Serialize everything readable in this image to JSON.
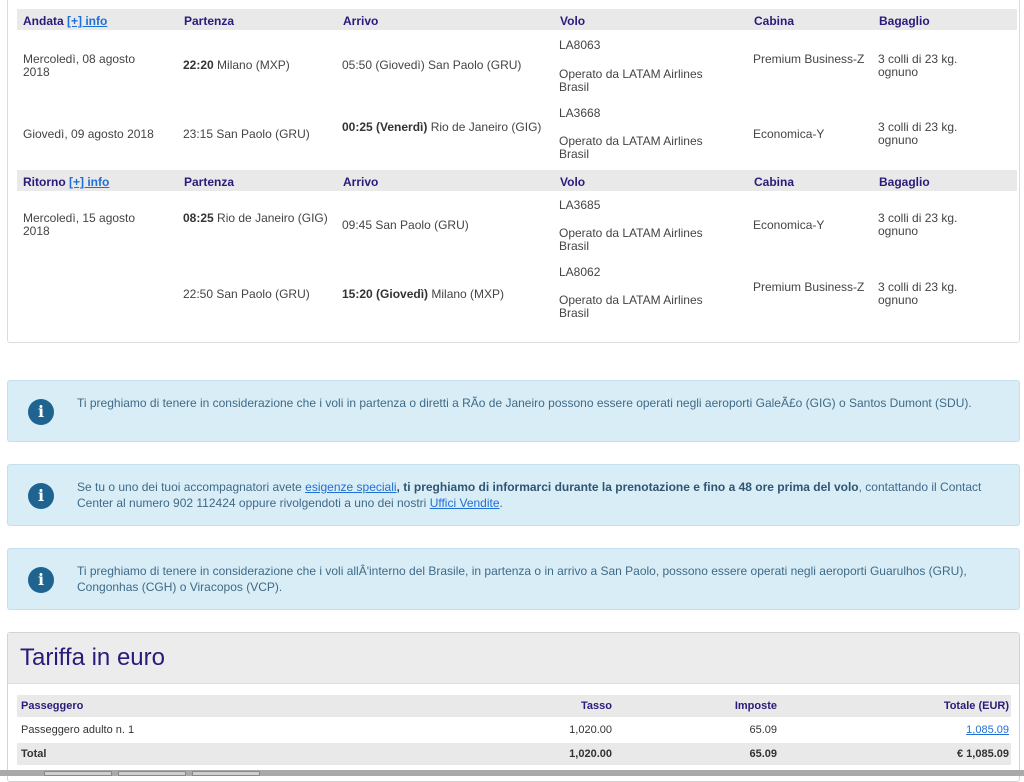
{
  "outbound": {
    "headers": {
      "section": "Andata",
      "info_link": "[+] info",
      "departure": "Partenza",
      "arrival": "Arrivo",
      "flight": "Volo",
      "cabin": "Cabina",
      "baggage": "Bagaglio"
    },
    "rows": [
      {
        "date": "Mercoledì, 08 agosto 2018",
        "dep_time": "22:20",
        "dep_place": "Milano (MXP)",
        "arr_time": "",
        "arr_place": "05:50 (Giovedì) San Paolo (GRU)",
        "flight_no": "LA8063",
        "operated": "Operato da LATAM Airlines Brasil",
        "cabin": "Premium Business-Z",
        "baggage": "3 colli di 23 kg. ognuno"
      },
      {
        "date": "Giovedì, 09 agosto 2018",
        "dep_time": "",
        "dep_place": "23:15 San Paolo (GRU)",
        "arr_time": "00:25 (Venerdì)",
        "arr_place": "Rio de Janeiro (GIG)",
        "flight_no": "LA3668",
        "operated": "Operato da LATAM Airlines Brasil",
        "cabin": "Economica-Y",
        "baggage": "3 colli di 23 kg. ognuno"
      }
    ]
  },
  "return": {
    "headers": {
      "section": "Ritorno",
      "info_link": "[+] info",
      "departure": "Partenza",
      "arrival": "Arrivo",
      "flight": "Volo",
      "cabin": "Cabina",
      "baggage": "Bagaglio"
    },
    "rows": [
      {
        "date": "Mercoledì, 15 agosto 2018",
        "dep_time": "08:25",
        "dep_place": "Rio de Janeiro (GIG)",
        "arr_time": "",
        "arr_place": "09:45 San Paolo (GRU)",
        "flight_no": "LA3685",
        "operated": "Operato da LATAM Airlines Brasil",
        "cabin": "Economica-Y",
        "baggage": "3 colli di 23 kg. ognuno"
      },
      {
        "date": "",
        "dep_time": "",
        "dep_place": "22:50 San Paolo (GRU)",
        "arr_time": "15:20 (Giovedì)",
        "arr_place": "Milano (MXP)",
        "flight_no": "LA8062",
        "operated": "Operato da LATAM Airlines Brasil",
        "cabin": "Premium Business-Z",
        "baggage": "3 colli di 23 kg. ognuno"
      }
    ]
  },
  "notices": {
    "rio": "Ti preghiamo di tenere in considerazione che i voli in partenza o diretti a RÃo de Janeiro possono essere operati negli aeroporti GaleÃ£o (GIG) o Santos Dumont (SDU).",
    "special": {
      "pre": "Se tu o uno dei tuoi accompagnatori avete ",
      "link1": "esigenze speciali",
      "bold": ", ti preghiamo di informarci durante la prenotazione e fino a 48 ore prima del volo",
      "mid": ", contattando il Contact Center al numero 902 112424 oppure rivolgendoti a uno dei nostri ",
      "link2": "Uffici Vendite",
      "post": "."
    },
    "brazil": "Ti preghiamo di tenere in considerazione che i voli allÂ'interno del Brasile, in partenza o in arrivo a San Paolo, possono essere operati negli aeroporti Guarulhos (GRU), Congonhas (CGH) o Viracopos (VCP).",
    "icon": "info-icon"
  },
  "fare": {
    "title": "Tariffa in euro",
    "headers": {
      "passenger": "Passeggero",
      "rate": "Tasso",
      "taxes": "Imposte",
      "total": "Totale (EUR)"
    },
    "row": {
      "passenger": "Passeggero adulto n. 1",
      "rate": "1,020.00",
      "taxes": "65.09",
      "total": "1,085.09"
    },
    "totals": {
      "label": "Total",
      "rate": "1,020.00",
      "taxes": "65.09",
      "total": "€ 1,085.09"
    }
  },
  "colors": {
    "header_text": "#2b1a7a",
    "link": "#1f6fd6",
    "info_bg": "#d9edf7",
    "info_icon": "#1f6390"
  }
}
